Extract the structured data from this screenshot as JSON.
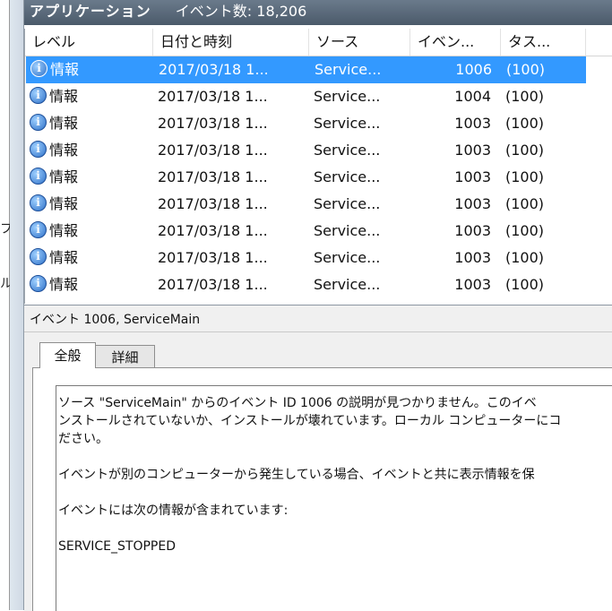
{
  "left_fragments": [
    "フ",
    "ル"
  ],
  "header": {
    "app_name": "アプリケーション",
    "event_count_label": "イベント数: 18,206"
  },
  "table": {
    "columns": [
      "レベル",
      "日付と時刻",
      "ソース",
      "イベン...",
      "タス..."
    ],
    "rows": [
      {
        "level": "情報",
        "datetime": "2017/03/18 1...",
        "source": "Service...",
        "event_id": "1006",
        "task": "(100)",
        "selected": true
      },
      {
        "level": "情報",
        "datetime": "2017/03/18 1...",
        "source": "Service...",
        "event_id": "1004",
        "task": "(100)",
        "selected": false
      },
      {
        "level": "情報",
        "datetime": "2017/03/18 1...",
        "source": "Service...",
        "event_id": "1003",
        "task": "(100)",
        "selected": false
      },
      {
        "level": "情報",
        "datetime": "2017/03/18 1...",
        "source": "Service...",
        "event_id": "1003",
        "task": "(100)",
        "selected": false
      },
      {
        "level": "情報",
        "datetime": "2017/03/18 1...",
        "source": "Service...",
        "event_id": "1003",
        "task": "(100)",
        "selected": false
      },
      {
        "level": "情報",
        "datetime": "2017/03/18 1...",
        "source": "Service...",
        "event_id": "1003",
        "task": "(100)",
        "selected": false
      },
      {
        "level": "情報",
        "datetime": "2017/03/18 1...",
        "source": "Service...",
        "event_id": "1003",
        "task": "(100)",
        "selected": false
      },
      {
        "level": "情報",
        "datetime": "2017/03/18 1...",
        "source": "Service...",
        "event_id": "1003",
        "task": "(100)",
        "selected": false
      },
      {
        "level": "情報",
        "datetime": "2017/03/18 1...",
        "source": "Service...",
        "event_id": "1003",
        "task": "(100)",
        "selected": false
      }
    ]
  },
  "details": {
    "title": "イベント 1006, ServiceMain",
    "tabs": [
      {
        "label": "全般",
        "active": true
      },
      {
        "label": "詳細",
        "active": false
      }
    ],
    "description_lines": [
      "ソース \"ServiceMain\" からのイベント ID 1006 の説明が見つかりません。このイベ",
      "ンストールされていないか、インストールが壊れています。ローカル コンピューターにコ",
      "ださい。",
      "",
      "イベントが別のコンピューターから発生している場合、イベントと共に表示情報を保",
      "",
      "イベントには次の情報が含まれています:",
      "",
      "SERVICE_STOPPED"
    ]
  },
  "colors": {
    "selection": "#3399ff",
    "header_bg": "#5a6a7b",
    "info_icon": "#2d6fc7"
  },
  "icons": {
    "info": "info-icon"
  }
}
